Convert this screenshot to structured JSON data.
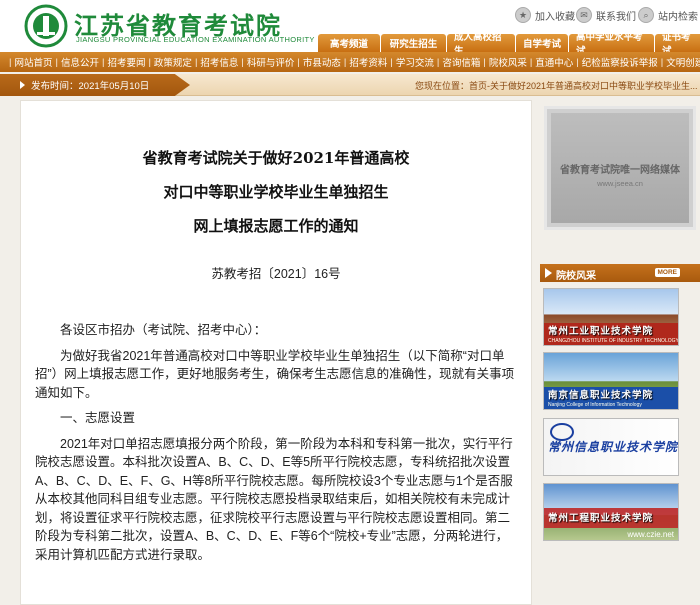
{
  "header": {
    "site_title": "江苏省教育考试院",
    "site_subtitle": "JIANGSU PROVINCIAL EDUCATION EXAMINATION AUTHORITY",
    "util_links": [
      {
        "label": "加入收藏",
        "icon": "bookmark-icon"
      },
      {
        "label": "联系我们",
        "icon": "contact-icon"
      },
      {
        "label": "站内检索",
        "icon": "search-icon"
      }
    ],
    "tabs": [
      "高考频道",
      "研究生招生",
      "成人高校招生",
      "自学考试",
      "高中学业水平考试",
      "证书考试"
    ],
    "accent": "#c86f12",
    "brand_green": "#1f8a3a"
  },
  "nav": {
    "items": [
      "网站首页",
      "信息公开",
      "招考要闻",
      "政策规定",
      "招考信息",
      "科研与评价",
      "市县动态",
      "招考资料",
      "学习交流",
      "咨询信箱",
      "院校风采",
      "直通中心",
      "纪检监察投诉举报",
      "文明创建"
    ]
  },
  "infobar": {
    "date": "发布时间：2021年05月10日",
    "breadcrumb": "您现在位置：首页-关于做好2021年普通高校对口中等职业学校毕业生..."
  },
  "article": {
    "title_lines": [
      "省教育考试院关于做好2021年普通高校",
      "对口中等职业学校毕业生单独招生",
      "网上填报志愿工作的通知"
    ],
    "doc_number": "苏教考招〔2021〕16号",
    "salutation": "各设区市招办（考试院、招考中心）：",
    "paragraphs": [
      "为做好我省2021年普通高校对口中等职业学校毕业生单独招生（以下简称“对口单招”）网上填报志愿工作，更好地服务考生，确保考生志愿信息的准确性，现就有关事项通知如下。",
      "一、志愿设置",
      "2021年对口单招志愿填报分两个阶段，第一阶段为本科和专科第一批次，实行平行院校志愿设置。本科批次设置A、B、C、D、E等5所平行院校志愿，专科统招批次设置A、B、C、D、E、F、G、H等8所平行院校志愿。每所院校设3个专业志愿与1个是否服从本校其他同科目组专业志愿。平行院校志愿投档录取结束后，如相关院校有未完成计划，将设置征求平行院校志愿，征求院校平行志愿设置与平行院校志愿设置相同。第二阶段为专科第二批次，设置A、B、C、D、E、F等6个“院校+专业”志愿，分两轮进行，采用计算机匹配方式进行录取。"
    ]
  },
  "sidebar": {
    "banner_text": "省教育考试院唯一网络媒体",
    "banner_url": "www.jseea.cn",
    "section_title": "院校风采",
    "more_label": "MORE",
    "schools": [
      {
        "name": "常州工业职业技术学院",
        "en": "CHANGZHOU INSTITUTE OF INDUSTRY TECHNOLOGY"
      },
      {
        "name": "南京信息职业技术学院",
        "en": "Nanjing College of Information Technology"
      },
      {
        "name": "常州信息职业技术学院",
        "en": ""
      },
      {
        "name": "常州工程职业技术学院",
        "en": "",
        "url": "www.czie.net"
      }
    ]
  }
}
